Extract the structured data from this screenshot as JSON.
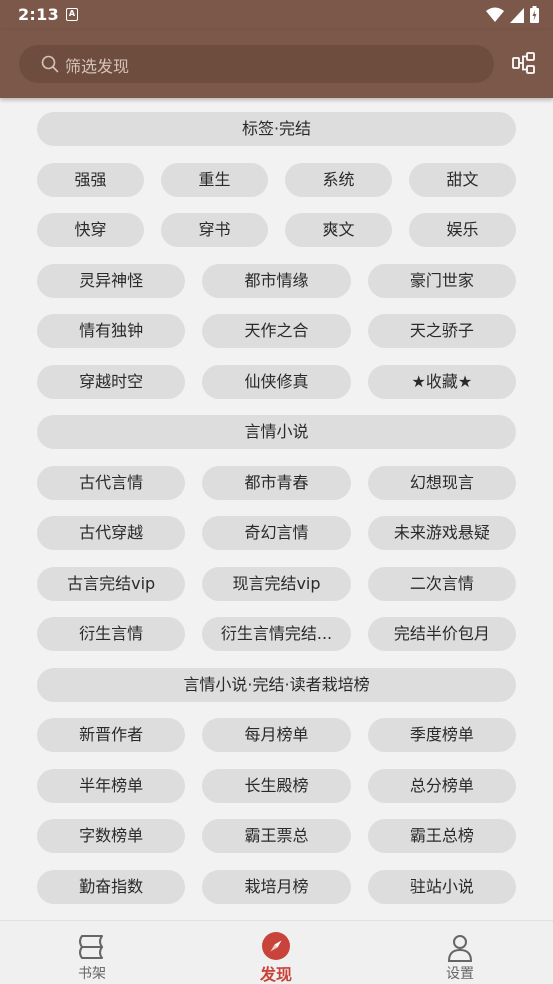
{
  "status": {
    "time": "2:13",
    "a_badge": "A"
  },
  "search": {
    "placeholder": "筛选发现"
  },
  "sections": [
    {
      "title": "标签·完结",
      "rows": [
        [
          "强强",
          "重生",
          "系统",
          "甜文"
        ],
        [
          "快穿",
          "穿书",
          "爽文",
          "娱乐"
        ],
        [
          "灵异神怪",
          "都市情缘",
          "豪门世家"
        ],
        [
          "情有独钟",
          "天作之合",
          "天之骄子"
        ],
        [
          "穿越时空",
          "仙侠修真",
          "★收藏★"
        ]
      ]
    },
    {
      "title": "言情小说",
      "rows": [
        [
          "古代言情",
          "都市青春",
          "幻想现言"
        ],
        [
          "古代穿越",
          "奇幻言情",
          "未来游戏悬疑"
        ],
        [
          "古言完结vip",
          "现言完结vip",
          "二次言情"
        ],
        [
          "衍生言情",
          "衍生言情完结...",
          "完结半价包月"
        ]
      ]
    },
    {
      "title": "言情小说·完结·读者栽培榜",
      "rows": [
        [
          "新晋作者",
          "每月榜单",
          "季度榜单"
        ],
        [
          "半年榜单",
          "长生殿榜",
          "总分榜单"
        ],
        [
          "字数榜单",
          "霸王票总",
          "霸王总榜"
        ],
        [
          "勤奋指数",
          "栽培月榜",
          "驻站小说"
        ]
      ]
    }
  ],
  "bottom_nav": [
    {
      "label": "书架",
      "icon": "bookshelf-icon",
      "active": false
    },
    {
      "label": "发现",
      "icon": "compass-icon",
      "active": true
    },
    {
      "label": "设置",
      "icon": "person-icon",
      "active": false
    }
  ],
  "colors": {
    "appbar": "#7b5849",
    "active": "#c8443a",
    "pill": "#dddddd"
  }
}
